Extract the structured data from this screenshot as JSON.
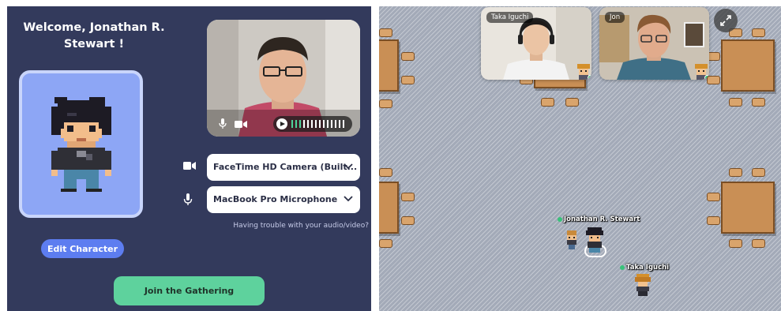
{
  "lobby": {
    "welcome": "Welcome, Jonathan R. Stewart !",
    "edit_character_label": "Edit Character",
    "camera_device": "FaceTime HD Camera (Built...",
    "microphone_device": "MacBook Pro Microphone",
    "trouble_link": "Having trouble with your audio/video?",
    "join_label": "Join the Gathering",
    "mic_level": 0.18,
    "colors": {
      "panel_bg": "#333a5c",
      "avatar_card_bg": "#8da6f5",
      "edit_button": "#5d7df0",
      "join_button": "#5ed29d"
    }
  },
  "map": {
    "video_tiles": [
      {
        "name": "Taka Iguchi"
      },
      {
        "name": "Jon"
      }
    ],
    "players": [
      {
        "name": "Jonathan R. Stewart"
      },
      {
        "name": "Taka Iguchi"
      }
    ],
    "icons": [
      "expand-icon",
      "online-status-icon"
    ],
    "floor_color": "#a3aab8",
    "table_color": "#c98f55"
  }
}
